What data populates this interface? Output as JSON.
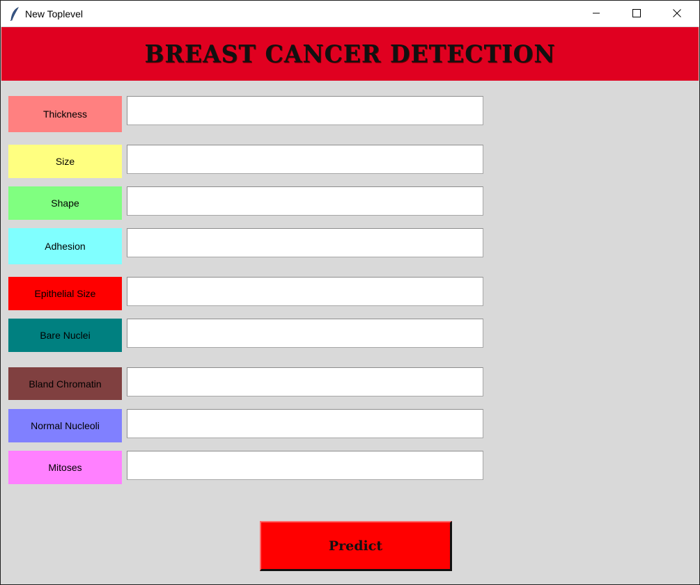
{
  "window": {
    "title": "New Toplevel",
    "app_icon": "feather-icon",
    "controls": {
      "minimize_icon": "minimize-icon",
      "maximize_icon": "maximize-icon",
      "close_icon": "close-icon"
    }
  },
  "header": {
    "title": "BREAST CANCER DETECTION",
    "background": "#e00020"
  },
  "fields": [
    {
      "label": "Thickness",
      "color": "#ff8080",
      "value": ""
    },
    {
      "label": "Size",
      "color": "#ffff80",
      "value": ""
    },
    {
      "label": "Shape",
      "color": "#80ff80",
      "value": ""
    },
    {
      "label": "Adhesion",
      "color": "#80ffff",
      "value": ""
    },
    {
      "label": "Epithelial Size",
      "color": "#ff0000",
      "value": ""
    },
    {
      "label": "Bare Nuclei",
      "color": "#008080",
      "value": ""
    },
    {
      "label": "Bland Chromatin",
      "color": "#804040",
      "value": ""
    },
    {
      "label": "Normal Nucleoli",
      "color": "#8080ff",
      "value": ""
    },
    {
      "label": "Mitoses",
      "color": "#ff80ff",
      "value": ""
    }
  ],
  "predict_button": {
    "label": "Predict",
    "color": "#ff0000"
  }
}
